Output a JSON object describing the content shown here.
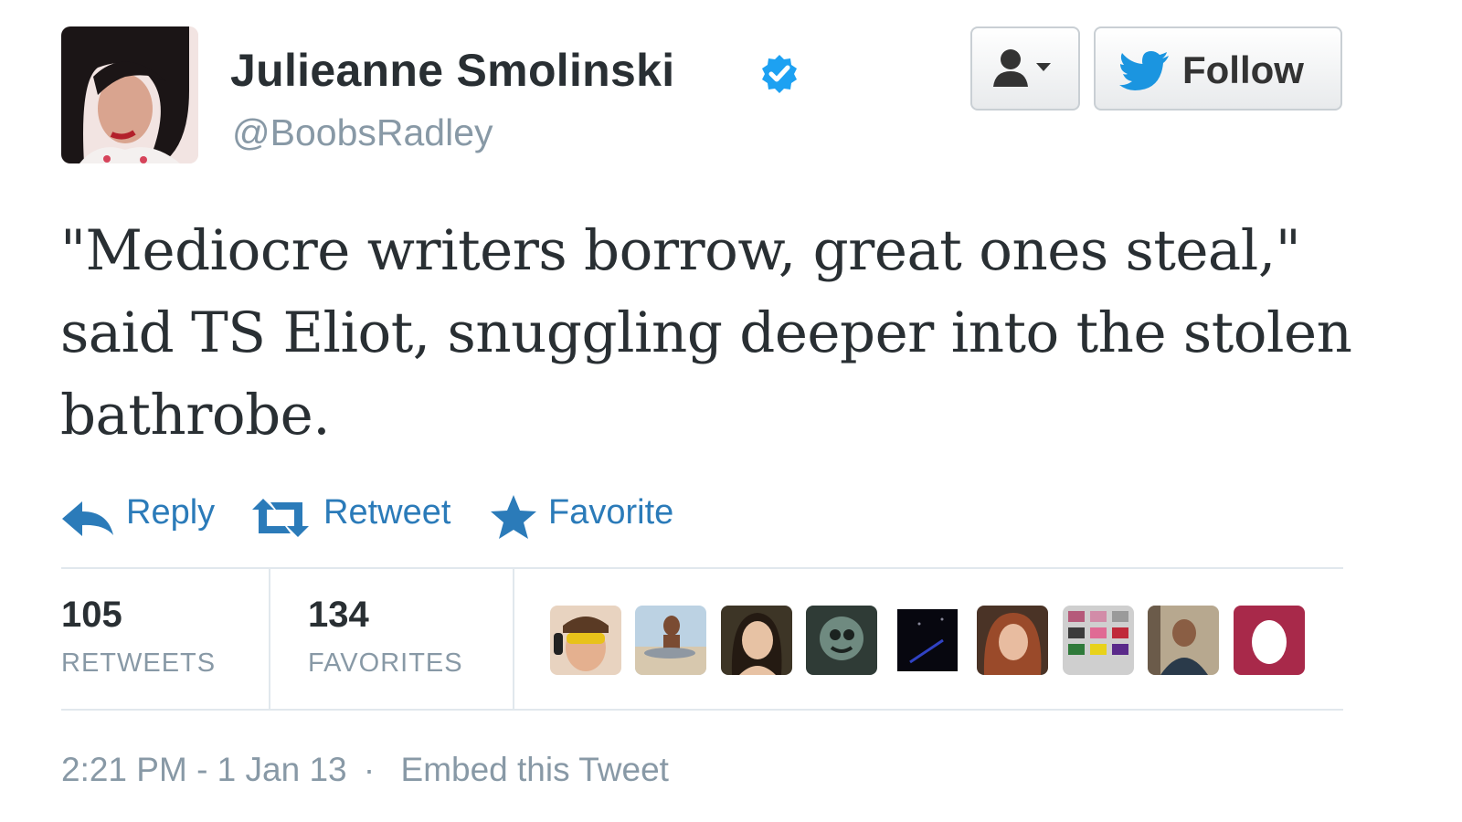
{
  "author": {
    "name": "Julieanne Smolinski",
    "handle": "@BoobsRadley",
    "verified_icon": "verified-badge-icon"
  },
  "header_buttons": {
    "user_actions_icon": "user-dropdown-icon",
    "follow_label": "Follow",
    "follow_icon": "twitter-bird-icon"
  },
  "tweet": {
    "text": "\"Mediocre writers borrow, great ones steal,\" said TS Eliot, snuggling deeper into the stolen bathrobe."
  },
  "actions": {
    "reply": "Reply",
    "retweet": "Retweet",
    "favorite": "Favorite"
  },
  "stats": {
    "retweets_count": "105",
    "retweets_label": "RETWEETS",
    "favorites_count": "134",
    "favorites_label": "FAVORITES"
  },
  "favoriters_count": 9,
  "colors": {
    "link": "#2b7bb9",
    "verified": "#1da1f2",
    "follow_bird": "#1b95e0",
    "muted_text": "#8899a6",
    "last_avatar": "#a8294a"
  },
  "footer": {
    "timestamp": "2:21 PM - 1 Jan 13",
    "separator": "·",
    "embed": "Embed this Tweet"
  }
}
